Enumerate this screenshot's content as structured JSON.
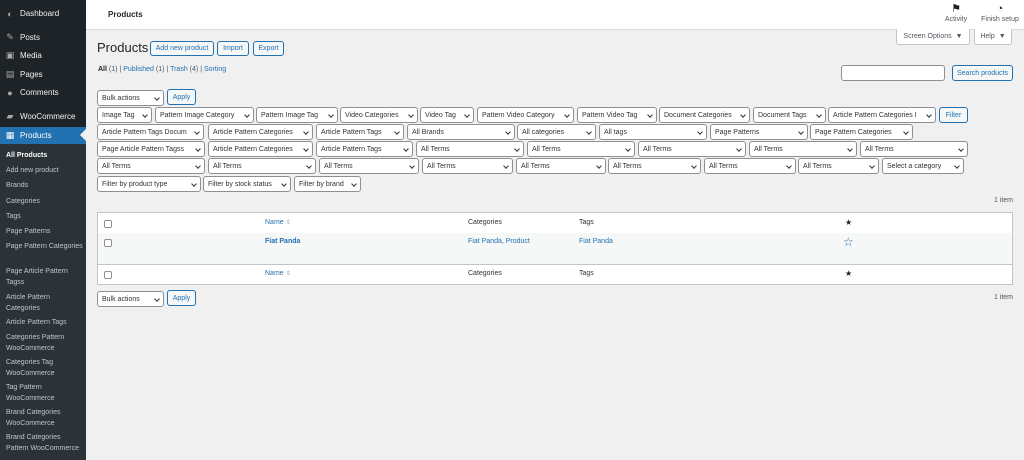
{
  "sidebar": {
    "items": [
      {
        "label": "Dashboard",
        "icon": "dashboard-icon",
        "glyph": "◐"
      },
      {
        "label": "Posts",
        "icon": "pin-icon",
        "glyph": "✎"
      },
      {
        "label": "Media",
        "icon": "media-icon",
        "glyph": "▣"
      },
      {
        "label": "Pages",
        "icon": "pages-icon",
        "glyph": "▤"
      },
      {
        "label": "Comments",
        "icon": "comments-icon",
        "glyph": "●"
      },
      {
        "label": "WooCommerce",
        "icon": "woocommerce-icon",
        "glyph": "▰"
      },
      {
        "label": "Products",
        "icon": "products-icon",
        "glyph": "▦"
      }
    ],
    "submenu": [
      "All Products",
      "Add new product",
      "Brands",
      "Categories",
      "Tags",
      "Page Patterns",
      "Page Pattern Categories",
      "Page Article Pattern Tagss",
      "Article Pattern Categories",
      "Article Pattern Tags",
      "Categories Pattern WooCommerce",
      "Categories Tag WooCommerce",
      "Tag Pattern WooCommerce",
      "Brand Categories WooCommerce",
      "Brand Categories Pattern WooCommerce"
    ]
  },
  "topbar": {
    "title": "Products",
    "activity": "Activity",
    "finish": "Finish setup",
    "activity_icon": "flag-icon",
    "finish_icon": "progress-circle-icon"
  },
  "screen_options": "Screen Options",
  "help": "Help",
  "heading": "Products",
  "page_buttons": [
    "Add new product",
    "Import",
    "Export"
  ],
  "views": {
    "all": "All",
    "all_count": "(1)",
    "published": "Published",
    "published_count": "(1)",
    "trash": "Trash",
    "trash_count": "(4)",
    "sorting": "Sorting",
    "sep": "|"
  },
  "search": {
    "value": "",
    "button": "Search products"
  },
  "bulk_actions": "Bulk actions",
  "apply": "Apply",
  "filter": "Filter",
  "filters": {
    "row1": [
      "Image Tag",
      "Pattern Image Category",
      "Pattern Image Tag",
      "Video Categories",
      "Video Tag",
      "Pattern Video Category",
      "Pattern Video Tag",
      "Document Categories",
      "Document Tags",
      "Article Pattern Categories I"
    ],
    "row2": [
      "Article Pattern Tags Docum",
      "Article Pattern Categories",
      "Article Pattern Tags",
      "All Brands",
      "All categories",
      "All tags",
      "Page Patterns",
      "Page Pattern Categories"
    ],
    "row3": [
      "Page Article Pattern Tagss",
      "Article Pattern Categories",
      "Article Pattern Tags",
      "All Terms",
      "All Terms",
      "All Terms",
      "All Terms",
      "All Terms"
    ],
    "row4": [
      "All Terms",
      "All Terms",
      "All Terms",
      "All Terms",
      "All Terms",
      "All Terms",
      "All Terms",
      "All Terms",
      "Select a category"
    ],
    "row5": [
      "Filter by product type",
      "Filter by stock status",
      "Filter by brand"
    ]
  },
  "items_count": "1 item",
  "table": {
    "columns": {
      "name": "Name",
      "categories": "Categories",
      "tags": "Tags",
      "featured": "★"
    },
    "rows": [
      {
        "name": "Fiat Panda",
        "categories": "Fiat Panda, Product",
        "tags": "Fiat Panda",
        "featured": "☆"
      }
    ]
  }
}
